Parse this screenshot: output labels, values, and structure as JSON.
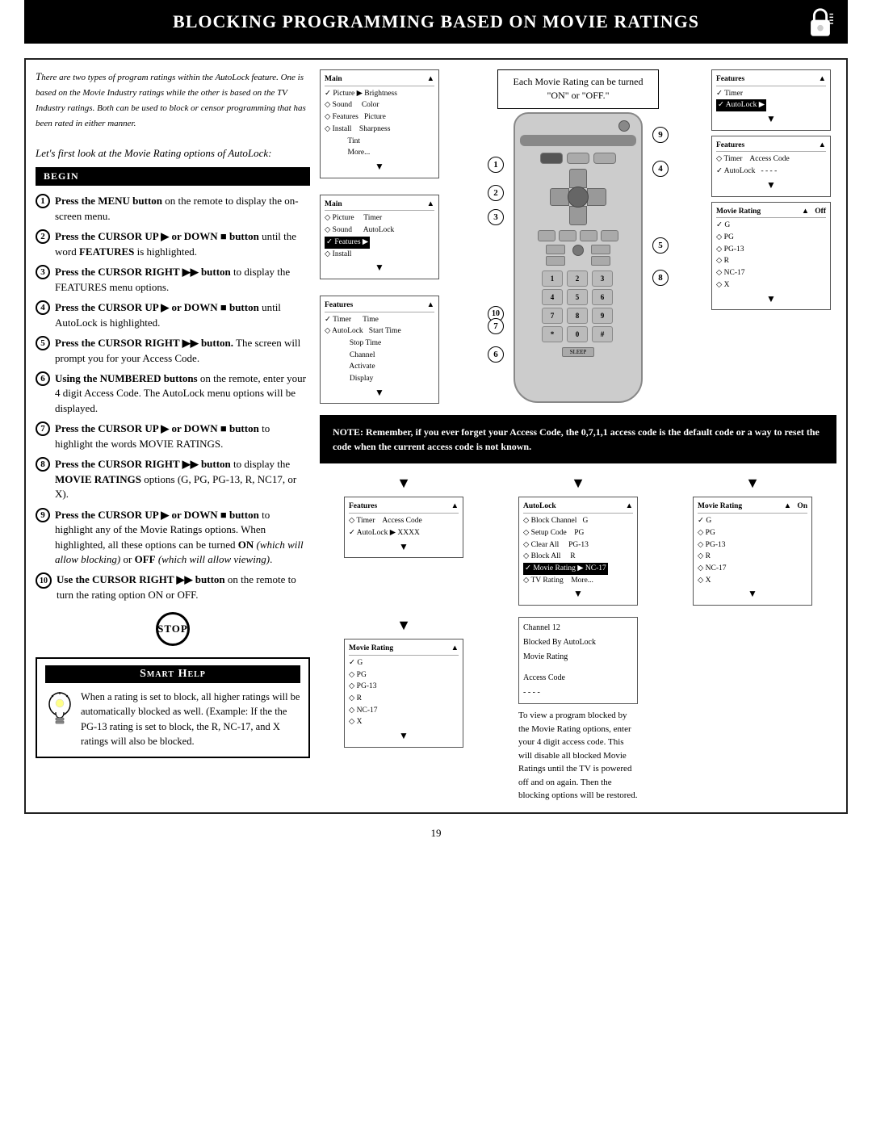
{
  "header": {
    "title": "Blocking Programming Based on Movie Ratings"
  },
  "intro": {
    "text1": "There are two types of program ratings within the AutoLock feature. One is based on the Movie Industry ratings while the other is based on the TV Industry ratings. Both can be used to block or censor programming that has been rated in either manner.",
    "text2": "Let's first look at the Movie Rating options of AutoLock:"
  },
  "begin_label": "BEGIN",
  "steps": [
    {
      "num": "1",
      "text": "Press the MENU button on the remote to display the on-screen menu."
    },
    {
      "num": "2",
      "text": "Press the CURSOR UP ▶ or DOWN ■ button until the word FEATURES is highlighted."
    },
    {
      "num": "3",
      "text": "Press the CURSOR RIGHT ▶▶ button to display the FEATURES menu options."
    },
    {
      "num": "4",
      "text": "Press the CURSOR UP ▶ or DOWN ■ button until AutoLock is highlighted."
    },
    {
      "num": "5",
      "text": "Press the CURSOR RIGHT ▶▶ button. The screen will prompt you for your Access Code."
    },
    {
      "num": "6",
      "text": "Using the NUMBERED buttons on the remote, enter your 4 digit Access Code. The AutoLock menu options will be displayed."
    },
    {
      "num": "7",
      "text": "Press the CURSOR UP ▶ or DOWN ■ button to highlight the words MOVIE RATINGS."
    },
    {
      "num": "8",
      "text": "Press the CURSOR RIGHT ▶▶ button to display the MOVIE RATINGS options (G, PG, PG-13, R, NC17, or X)."
    },
    {
      "num": "9",
      "text": "Press the CURSOR UP ▶ or DOWN ■ button to highlight any of the Movie Ratings options. When highlighted, all these options can be turned ON (which will allow blocking) or OFF (which will allow viewing)."
    },
    {
      "num": "10",
      "text": "Use the CURSOR RIGHT ▶▶ button on the remote to turn the rating option ON or OFF."
    }
  ],
  "stop_label": "STOP",
  "smart_help": {
    "title": "Smart Help",
    "text": "When a rating is set to block, all higher ratings will be automatically blocked as well. (Example: If the the PG-13 rating is set to block, the R, NC-17, and X ratings will also be blocked."
  },
  "callout": {
    "text": "Each Movie Rating can be turned \"ON\" or \"OFF.\""
  },
  "note": {
    "text": "NOTE: Remember, if you ever forget your Access Code, the 0,7,1,1 access code is the default code or a way to reset the code when the current access code is not known."
  },
  "screens": {
    "screen1": {
      "header_left": "Main",
      "header_right": "▲",
      "rows": [
        "✓ Picture  ▶  Brightness",
        "◇ Sound        Color",
        "◇ Features     Picture",
        "◇ Install      Sharpness",
        "             Tint",
        "             More..."
      ]
    },
    "screen2": {
      "header_left": "Main",
      "rows": [
        "◇ Picture      Timer",
        "◇ Sound        AutoLock",
        "✓ Features  ▶",
        "◇ Install"
      ]
    },
    "screen3": {
      "header_left": "Features",
      "header_right": "▲",
      "rows": [
        "✓ Timer        Time",
        "◇ AutoLock     Start Time",
        "              Stop Time",
        "              Channel",
        "              Activate",
        "              Display"
      ]
    },
    "screen4": {
      "header_left": "Features",
      "header_right": "▲",
      "rows": [
        "✓ Timer",
        "✓ AutoLock  ▶"
      ]
    },
    "screen5": {
      "header_left": "Features",
      "header_right": "▲",
      "rows": [
        "◇ Timer        Access Code",
        "✓ AutoLock     - - - -"
      ]
    },
    "screen6": {
      "header_left": "Features",
      "rows": [
        "◇ Timer        Access Code",
        "✓ AutoLock  ▶  XXXX"
      ]
    },
    "screen7": {
      "header_left": "AutoLock",
      "header_right": "▲",
      "rows": [
        "◇ Block Channel   G",
        "◇ Setup Code      PG",
        "◇ Clear All       PG-13",
        "◇ Block All       R",
        "✓ Movie Rating ▶  NC-17",
        "◇ TV Rating       More..."
      ]
    },
    "screen8": {
      "header_left": "Movie Rating",
      "header_right": "▲",
      "rows": [
        "✓ G",
        "◇ PG",
        "◇ PG-13",
        "◇ R",
        "◇ NC-17",
        "◇ X"
      ],
      "col2": [
        "Off"
      ]
    },
    "screen9": {
      "header_left": "Movie Rating",
      "header_right": "▲",
      "rows": [
        "✓ G",
        "◇ PG",
        "◇ PG-13",
        "◇ R",
        "◇ NC-17",
        "◇ X"
      ],
      "col2": [
        "On"
      ]
    },
    "screen10": {
      "lines": [
        "Channel 12",
        "Blocked By AutoLock",
        "Movie Rating",
        "",
        "Access Code",
        "- - - -"
      ]
    }
  },
  "page_number": "19"
}
